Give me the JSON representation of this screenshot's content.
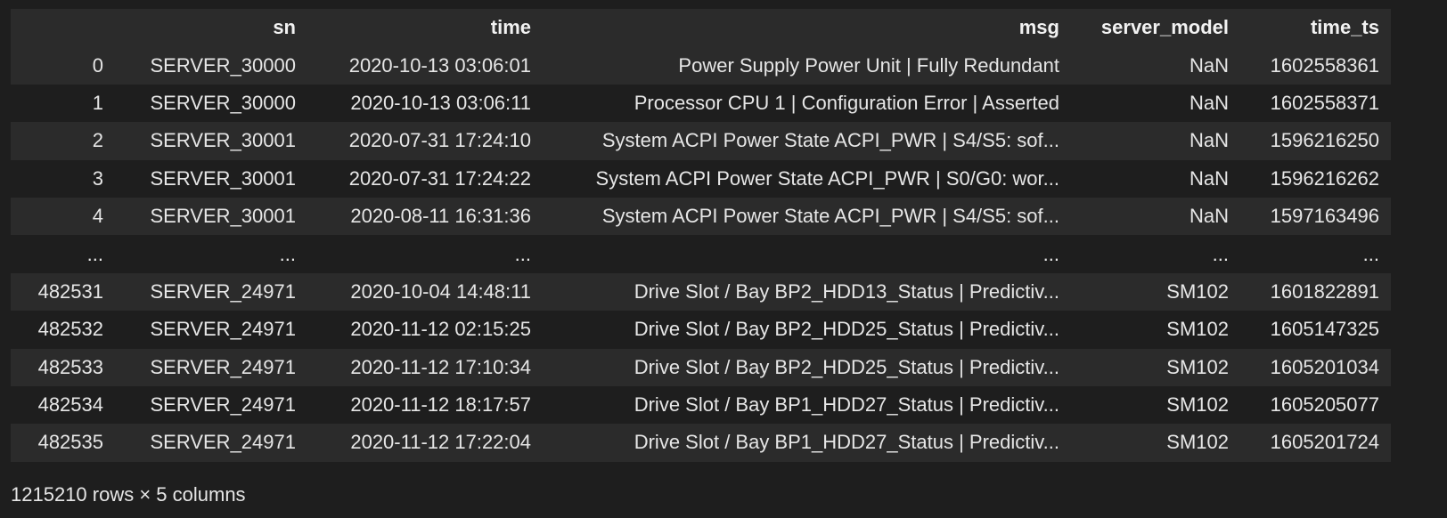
{
  "table": {
    "columns": [
      "",
      "sn",
      "time",
      "msg",
      "server_model",
      "time_ts"
    ],
    "rows": [
      {
        "index": "0",
        "sn": "SERVER_30000",
        "time": "2020-10-13 03:06:01",
        "msg": "Power Supply Power Unit | Fully Redundant",
        "server_model": "NaN",
        "time_ts": "1602558361"
      },
      {
        "index": "1",
        "sn": "SERVER_30000",
        "time": "2020-10-13 03:06:11",
        "msg": "Processor CPU 1 | Configuration Error | Asserted",
        "server_model": "NaN",
        "time_ts": "1602558371"
      },
      {
        "index": "2",
        "sn": "SERVER_30001",
        "time": "2020-07-31 17:24:10",
        "msg": "System ACPI Power State ACPI_PWR | S4/S5: sof...",
        "server_model": "NaN",
        "time_ts": "1596216250"
      },
      {
        "index": "3",
        "sn": "SERVER_30001",
        "time": "2020-07-31 17:24:22",
        "msg": "System ACPI Power State ACPI_PWR | S0/G0: wor...",
        "server_model": "NaN",
        "time_ts": "1596216262"
      },
      {
        "index": "4",
        "sn": "SERVER_30001",
        "time": "2020-08-11 16:31:36",
        "msg": "System ACPI Power State ACPI_PWR | S4/S5: sof...",
        "server_model": "NaN",
        "time_ts": "1597163496"
      },
      {
        "index": "...",
        "sn": "...",
        "time": "...",
        "msg": "...",
        "server_model": "...",
        "time_ts": "..."
      },
      {
        "index": "482531",
        "sn": "SERVER_24971",
        "time": "2020-10-04 14:48:11",
        "msg": "Drive Slot / Bay BP2_HDD13_Status | Predictiv...",
        "server_model": "SM102",
        "time_ts": "1601822891"
      },
      {
        "index": "482532",
        "sn": "SERVER_24971",
        "time": "2020-11-12 02:15:25",
        "msg": "Drive Slot / Bay BP2_HDD25_Status | Predictiv...",
        "server_model": "SM102",
        "time_ts": "1605147325"
      },
      {
        "index": "482533",
        "sn": "SERVER_24971",
        "time": "2020-11-12 17:10:34",
        "msg": "Drive Slot / Bay BP2_HDD25_Status | Predictiv...",
        "server_model": "SM102",
        "time_ts": "1605201034"
      },
      {
        "index": "482534",
        "sn": "SERVER_24971",
        "time": "2020-11-12 18:17:57",
        "msg": "Drive Slot / Bay BP1_HDD27_Status | Predictiv...",
        "server_model": "SM102",
        "time_ts": "1605205077"
      },
      {
        "index": "482535",
        "sn": "SERVER_24971",
        "time": "2020-11-12 17:22:04",
        "msg": "Drive Slot / Bay BP1_HDD27_Status | Predictiv...",
        "server_model": "SM102",
        "time_ts": "1605201724"
      }
    ]
  },
  "footer": {
    "shape_text": "1215210 rows × 5 columns"
  },
  "colors": {
    "background": "#1e1e1e",
    "row_stripe": "#2b2b2b",
    "text": "#e6e6e6"
  }
}
